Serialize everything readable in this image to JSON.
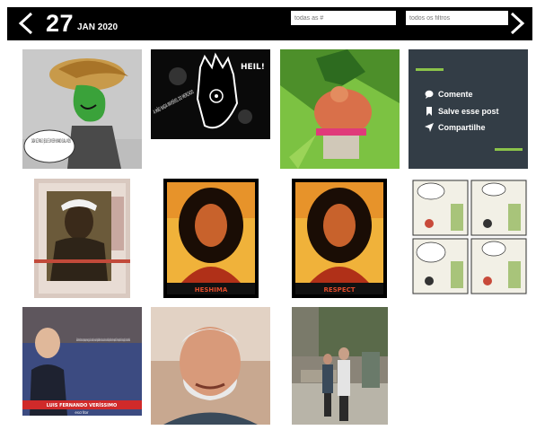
{
  "header": {
    "day": "27",
    "month_year": "JAN 2020",
    "tag_filter_placeholder": "todas as #",
    "filter_placeholder": "todos os filtros"
  },
  "promo": {
    "comment_label": "Comente",
    "save_label": "Salve esse post",
    "share_label": "Compartilhe"
  },
  "posts": {
    "hand_text": "A MÃO NADA INVISÍVEL DO MERCADO",
    "heil_text": "HEIL!",
    "cartoon_speech": "CADA VEZ MAIS O JEGUE É UM SER HUMANO IGUAL A NÓS!",
    "poster1_caption": "HESHIMA",
    "poster2_caption": "RESPECT",
    "quote_text": "Eu não entendo como uma pessoa que enxerga o país à sua volta, vive suas desigualdades e sabe a causa dos seus misérias pode não ser de esquerda. Ser de esquerda não é uma opção, é uma decorrência",
    "quote_author": "LUIS FERNANDO VERÍSSIMO",
    "quote_author_role": "escritor"
  },
  "colors": {
    "accent_green": "#8bc34a",
    "promo_bg": "#333d46",
    "topbar_bg": "#000000"
  }
}
